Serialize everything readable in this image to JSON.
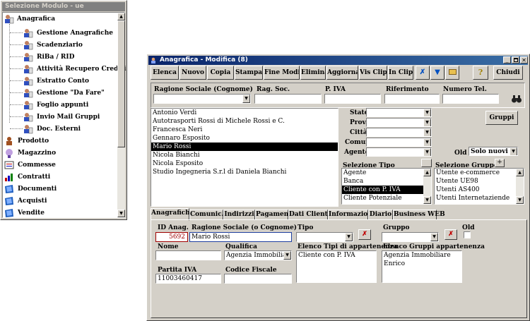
{
  "module_window": {
    "title": "Selezione Modulo - ue",
    "tree": {
      "anagrafica": "Anagrafica",
      "children": [
        "Gestione Anagrafiche",
        "Scadenziario",
        "RiBa / RID",
        "Attività Recupero Crediti",
        "Estratto Conto",
        "Gestione \"Da Fare\"",
        "Foglio appunti",
        "Invio Mail Gruppi",
        "Doc. Esterni"
      ],
      "roots": [
        "Prodotto",
        "Magazzino",
        "Commesse",
        "Contratti",
        "Documenti",
        "Acquisti",
        "Vendite"
      ]
    }
  },
  "main_window": {
    "title": "Anagrafica - Modifica  (8)",
    "toolbar": [
      "Elenca",
      "Nuovo",
      "Copia",
      "Stampa",
      "Fine Modif.",
      "Elimina",
      "Aggiorna",
      "Vis Clip",
      "In Clip"
    ],
    "chiudi": "Chiudi",
    "search": {
      "ragione_sociale_label": "Ragione Sociale (Cognome)",
      "rag_soc_label": "Rag. Soc.",
      "piva_label": "P. IVA",
      "riferimento_label": "Riferimento",
      "numero_tel_label": "Numero Tel."
    },
    "results": [
      "Antonio Verdi",
      "Autotrasporti Rossi di Michele Rossi e C.",
      "Francesca Neri",
      "Gennaro Esposito",
      "Mario Rossi",
      "Nicola Bianchi",
      "Nicola Esposito",
      "Studio Ingegneria S.r.l di Daniela Bianchi"
    ],
    "selected_result": "Mario Rossi",
    "filters": {
      "stato": "Stato",
      "prov": "Prov.",
      "citta": "Città",
      "comun": "Comun.",
      "agente": "Agente",
      "old_label": "Old",
      "old_value": "Solo nuovi",
      "gruppi_button": "Gruppi"
    },
    "selezione_tipo": {
      "label": "Selezione Tipo",
      "items": [
        "Agente",
        "Banca",
        "Cliente con P. IVA",
        "Cliente Potenziale"
      ],
      "selected": "Cliente con P. IVA"
    },
    "selezione_gruppo": {
      "label": "Selezione Gruppo",
      "plus": "+",
      "items": [
        "Utente e-commerce",
        "Utente UE98",
        "Utenti AS400",
        "Utenti Internetaziende"
      ]
    },
    "tabs": [
      "Anagrafiche",
      "Comunic.",
      "Indirizzi",
      "Pagamento",
      "Dati Cliente",
      "Informazioni",
      "Diario",
      "Business WEB"
    ],
    "detail": {
      "id_label": "ID Anag.",
      "id_value": "5692",
      "ragione_label": "Ragione Sociale (o Cognome)",
      "ragione_value": "Mario Rossi",
      "tipo_label": "Tipo",
      "gruppo_label": "Gruppo",
      "old_label": "Old",
      "nome_label": "Nome",
      "qualifica_label": "Qualifica",
      "qualifica_value": "Agenzia Immobiliare",
      "elenco_tipi_label": "Elenco Tipi di appartenenza",
      "elenco_tipi_items": [
        "Cliente con P. IVA"
      ],
      "elenco_gruppi_label": "Elenco Gruppi appartenenza",
      "elenco_gruppi_items": [
        "Agenzia Immobiliare",
        "Enrico"
      ],
      "partita_iva_label": "Partita IVA",
      "partita_iva_value": "11003460417",
      "codice_fiscale_label": "Codice Fiscale"
    }
  },
  "colors": {
    "titlebar_active": "#0a246a",
    "titlebar_inactive": "#808080",
    "window_face": "#d4d0c8",
    "selection": "#000000"
  }
}
